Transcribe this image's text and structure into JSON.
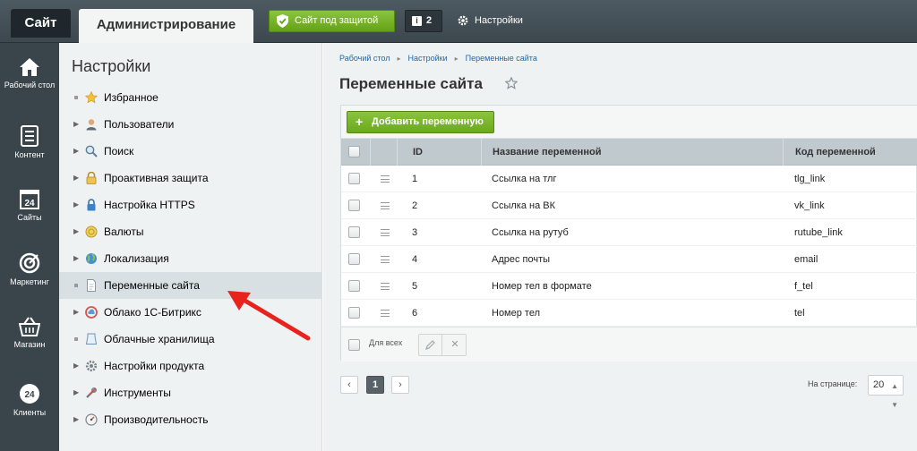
{
  "topbar": {
    "site_tab": "Сайт",
    "admin_tab": "Администрирование",
    "secure_label": "Сайт под защитой",
    "notif_count": "2",
    "settings_label": "Настройки"
  },
  "leftbar": {
    "items": [
      {
        "label": "Рабочий стол",
        "icon": "home-icon"
      },
      {
        "label": "Контент",
        "icon": "document-icon"
      },
      {
        "label": "Сайты",
        "icon": "calendar-24-icon"
      },
      {
        "label": "Маркетинг",
        "icon": "target-icon"
      },
      {
        "label": "Магазин",
        "icon": "basket-icon"
      },
      {
        "label": "Клиенты",
        "icon": "clients-24-icon"
      }
    ]
  },
  "menu": {
    "title": "Настройки",
    "items": [
      {
        "label": "Избранное",
        "icon": "star-icon",
        "expandable": false
      },
      {
        "label": "Пользователи",
        "icon": "user-icon",
        "expandable": true
      },
      {
        "label": "Поиск",
        "icon": "search-icon",
        "expandable": true
      },
      {
        "label": "Проактивная защита",
        "icon": "lock-icon",
        "expandable": true
      },
      {
        "label": "Настройка HTTPS",
        "icon": "https-lock-icon",
        "expandable": true
      },
      {
        "label": "Валюты",
        "icon": "currency-icon",
        "expandable": true
      },
      {
        "label": "Локализация",
        "icon": "globe-icon",
        "expandable": true
      },
      {
        "label": "Переменные сайта",
        "icon": "page-icon",
        "expandable": false,
        "active": true
      },
      {
        "label": "Облако 1С-Битрикс",
        "icon": "cloud-icon",
        "expandable": true
      },
      {
        "label": "Облачные хранилища",
        "icon": "storage-icon",
        "expandable": false
      },
      {
        "label": "Настройки продукта",
        "icon": "gear-icon",
        "expandable": true
      },
      {
        "label": "Инструменты",
        "icon": "tools-icon",
        "expandable": true
      },
      {
        "label": "Производительность",
        "icon": "speedometer-icon",
        "expandable": true
      }
    ]
  },
  "content": {
    "breadcrumb": [
      "Рабочий стол",
      "Настройки",
      "Переменные сайта"
    ],
    "title": "Переменные сайта",
    "add_button": "Добавить переменную",
    "table": {
      "headers": {
        "id": "ID",
        "name": "Название переменной",
        "code": "Код переменной"
      },
      "rows": [
        {
          "id": "1",
          "name": "Ссылка на тлг",
          "code": "tlg_link"
        },
        {
          "id": "2",
          "name": "Ссылка на ВК",
          "code": "vk_link"
        },
        {
          "id": "3",
          "name": "Ссылка на рутуб",
          "code": "rutube_link"
        },
        {
          "id": "4",
          "name": "Адрес почты",
          "code": "email"
        },
        {
          "id": "5",
          "name": "Номер тел в формате",
          "code": "f_tel"
        },
        {
          "id": "6",
          "name": "Номер тел",
          "code": "tel"
        }
      ]
    },
    "for_all_label": "Для всех",
    "pager": {
      "prev": "‹",
      "current": "1",
      "next": "›"
    },
    "per_page_label": "На странице:",
    "per_page_value": "20"
  },
  "colors": {
    "accent_green": "#6aa91c",
    "annotation_arrow": "#e8221c",
    "sidebar_bg": "#39444b"
  }
}
